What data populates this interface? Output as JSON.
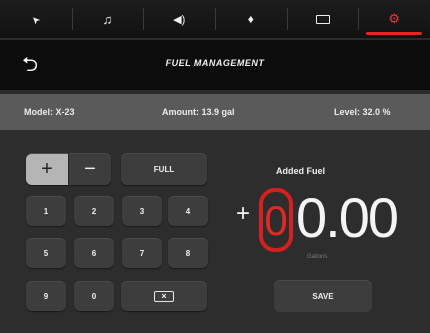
{
  "tabs": [
    {
      "name": "navigation",
      "icon": "navigation-arrow-icon",
      "glyph": "➤"
    },
    {
      "name": "music",
      "icon": "music-note-icon",
      "glyph": "♫"
    },
    {
      "name": "volume",
      "icon": "speaker-icon",
      "glyph": "🔈"
    },
    {
      "name": "location",
      "icon": "map-pin-icon",
      "glyph": "📍"
    },
    {
      "name": "card",
      "icon": "id-card-icon",
      "glyph": "▭"
    },
    {
      "name": "settings",
      "icon": "gear-icon",
      "glyph": "⚙",
      "active": true
    }
  ],
  "header": {
    "title": "FUEL MANAGEMENT",
    "back_glyph": "⮌"
  },
  "info": {
    "model": "Model: X-23",
    "amount": "Amount: 13.9 gal",
    "level": "Level: 32.0 %"
  },
  "keypad": {
    "plus": "+",
    "minus": "−",
    "full": "FULL",
    "keys": [
      "1",
      "2",
      "3",
      "4",
      "5",
      "6",
      "7",
      "8",
      "9",
      "0"
    ],
    "backspace_glyph": "⌫"
  },
  "display": {
    "label": "Added Fuel",
    "sign": "+",
    "first_digit": "0",
    "rest": "0.00",
    "unit": "Gallons"
  },
  "save_label": "SAVE",
  "colors": {
    "accent": "#e02828",
    "background": "#2d2d2d",
    "header": "#0c0c0c",
    "infobar": "#5a5a5a"
  }
}
